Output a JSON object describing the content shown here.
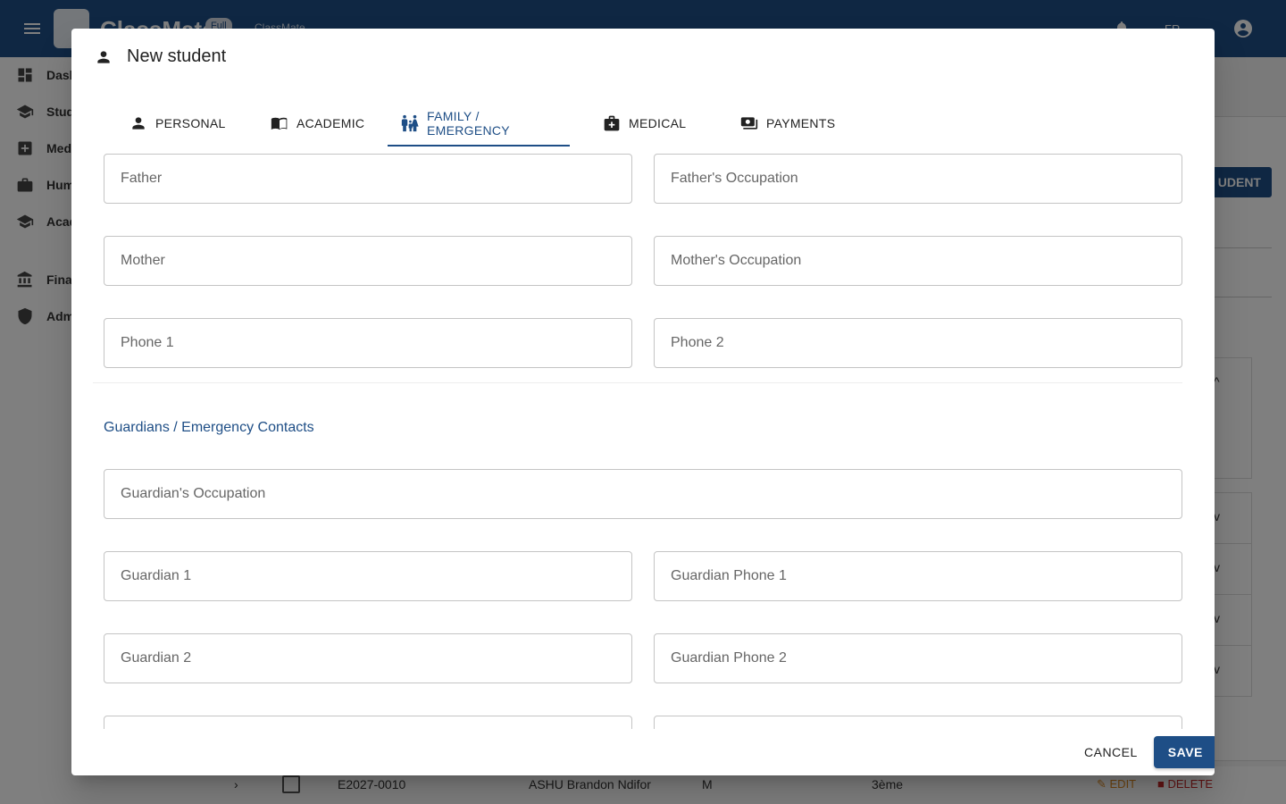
{
  "app": {
    "brand": "ClassMate",
    "badge": "Full",
    "subbrand": "ClassMate",
    "lang": "FR"
  },
  "sidebar": {
    "items": [
      {
        "label": "Dashboard",
        "icon": "dashboard-icon"
      },
      {
        "label": "Students",
        "icon": "school-icon"
      },
      {
        "label": "Medical",
        "icon": "medical-icon"
      },
      {
        "label": "Human Resources",
        "icon": "briefcase-icon"
      },
      {
        "label": "Academic Management",
        "icon": "school-icon"
      },
      {
        "label": "Finance",
        "icon": "bank-icon"
      },
      {
        "label": "Admin",
        "icon": "admin-shield-icon"
      }
    ]
  },
  "background": {
    "add_button": "UDENT",
    "row": {
      "id": "E2027-0010",
      "name": "ASHU Brandon Ndifor",
      "sex": "M",
      "class": "3ème",
      "edit": "EDIT",
      "delete": "DELETE"
    }
  },
  "dialog": {
    "title": "New student",
    "tabs": [
      {
        "label": "PERSONAL",
        "icon": "person-icon"
      },
      {
        "label": "ACADEMIC",
        "icon": "book-icon"
      },
      {
        "label": "FAMILY / EMERGENCY",
        "icon": "family-icon"
      },
      {
        "label": "MEDICAL",
        "icon": "medical-bag-icon"
      },
      {
        "label": "PAYMENTS",
        "icon": "payments-icon"
      }
    ],
    "active_tab": "FAMILY / EMERGENCY",
    "fields": {
      "father": "Father",
      "father_occupation": "Father's Occupation",
      "mother": "Mother",
      "mother_occupation": "Mother's Occupation",
      "phone1": "Phone 1",
      "phone2": "Phone 2",
      "guardian_occupation": "Guardian's Occupation",
      "guardian1": "Guardian 1",
      "guardian_phone1": "Guardian Phone 1",
      "guardian2": "Guardian 2",
      "guardian_phone2": "Guardian Phone 2"
    },
    "section_title": "Guardians / Emergency Contacts",
    "cancel_label": "CANCEL",
    "save_label": "SAVE"
  },
  "colors": {
    "primary": "#1e4e86",
    "danger": "#c62828",
    "edit": "#e08a1e"
  }
}
